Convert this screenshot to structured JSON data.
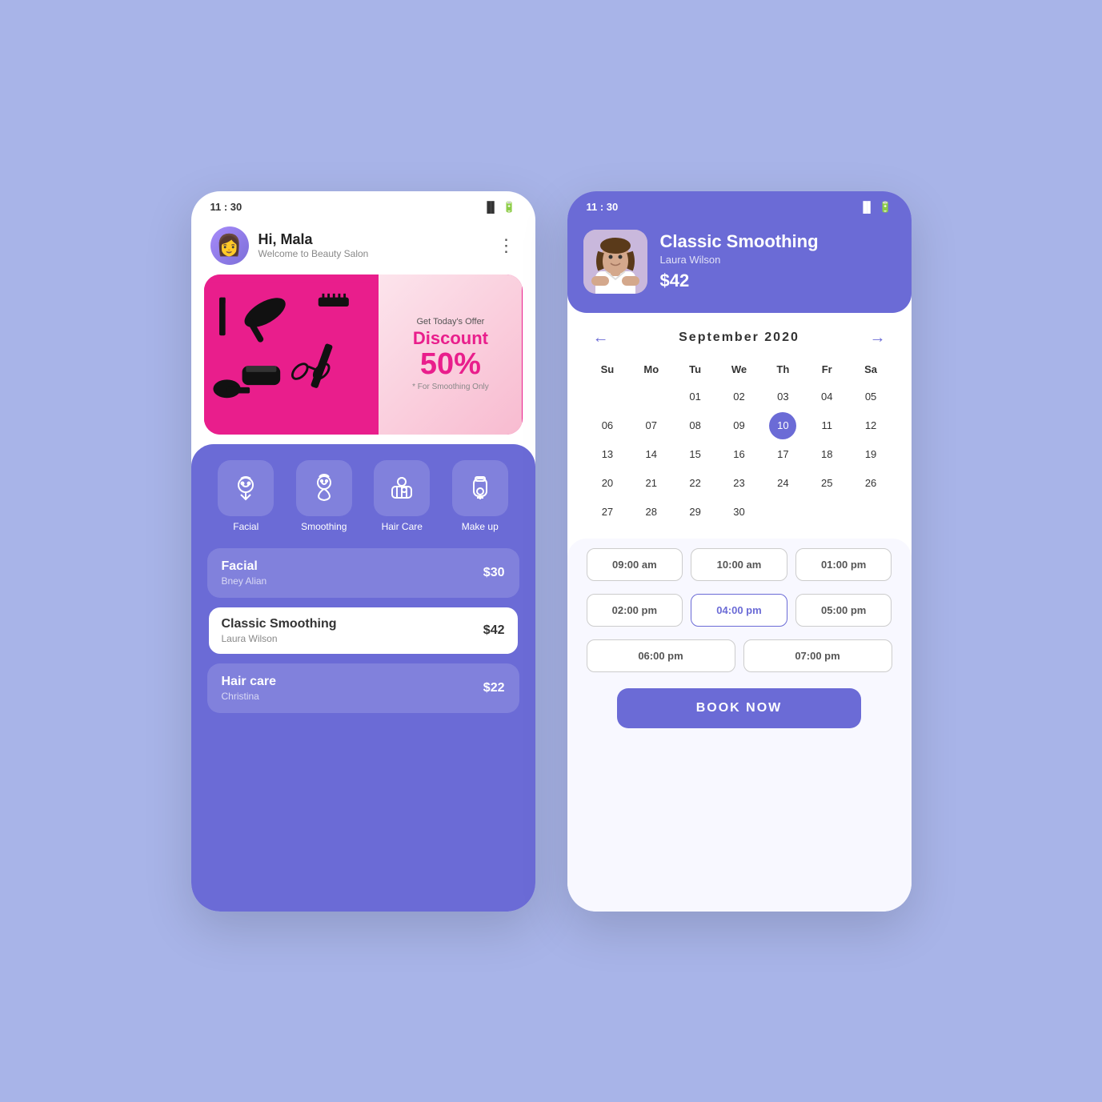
{
  "app": {
    "time": "11 : 30"
  },
  "left_phone": {
    "greeting": "Hi, Mala",
    "subtitle": "Welcome to Beauty Salon",
    "banner": {
      "offer_label": "Get Today's Offer",
      "discount_label": "Discount",
      "percent": "50%",
      "note": "* For Smoothing Only"
    },
    "categories": [
      {
        "label": "Facial"
      },
      {
        "label": "Smoothing"
      },
      {
        "label": "Hair Care"
      },
      {
        "label": "Make up"
      }
    ],
    "services": [
      {
        "name": "Facial",
        "sub": "Bney Alian",
        "price": "$30",
        "active": false
      },
      {
        "name": "Classic Smoothing",
        "sub": "Laura Wilson",
        "price": "$42",
        "active": true
      },
      {
        "name": "Hair care",
        "sub": "Christina",
        "price": "$22",
        "active": false
      }
    ]
  },
  "right_phone": {
    "booking": {
      "service_name": "Classic Smoothing",
      "stylist": "Laura Wilson",
      "price": "$42"
    },
    "calendar": {
      "month": "September 2020",
      "days_header": [
        "Su",
        "Mo",
        "Tu",
        "We",
        "Th",
        "Fr",
        "Sa"
      ],
      "selected_day": 10
    },
    "time_slots": [
      {
        "time": "09:00 am",
        "selected": false
      },
      {
        "time": "10:00 am",
        "selected": false
      },
      {
        "time": "01:00 pm",
        "selected": false
      },
      {
        "time": "02:00 pm",
        "selected": false
      },
      {
        "time": "04:00 pm",
        "selected": true
      },
      {
        "time": "05:00 pm",
        "selected": false
      },
      {
        "time": "06:00 pm",
        "selected": false
      },
      {
        "time": "07:00 pm",
        "selected": false
      }
    ],
    "book_button": "BOOK NOW"
  }
}
